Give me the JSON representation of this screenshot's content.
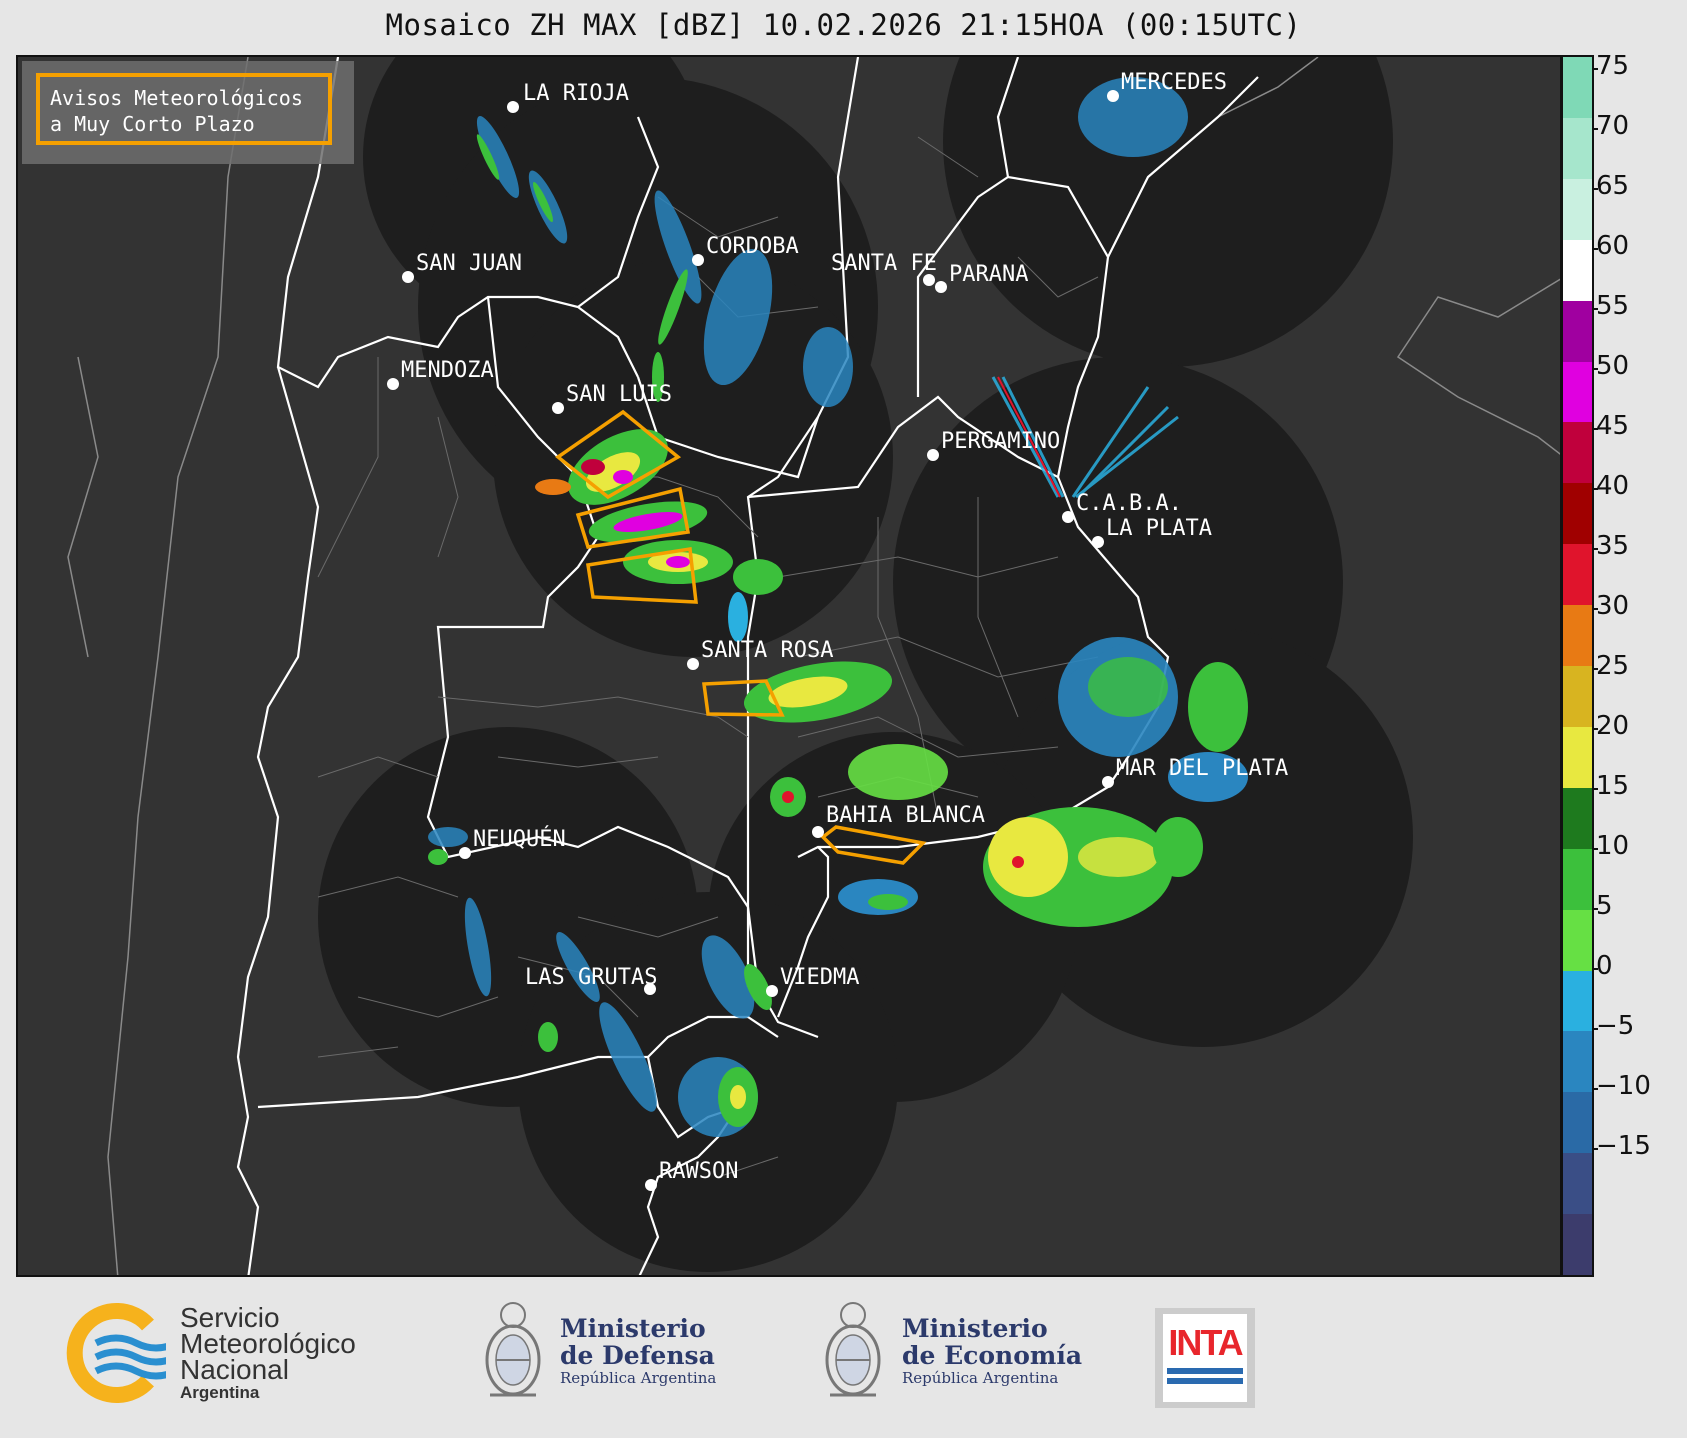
{
  "title": "Mosaico ZH MAX [dBZ] 10.02.2026 21:15HOA (00:15UTC)",
  "warning_box": {
    "line1": "Avisos Meteorológicos",
    "line2": "a Muy Corto Plazo",
    "border_color": "#f5a000"
  },
  "cities": [
    {
      "name": "LA RIOJA"
    },
    {
      "name": "CORDOBA"
    },
    {
      "name": "SAN JUAN"
    },
    {
      "name": "SANTA FE"
    },
    {
      "name": "PARANA"
    },
    {
      "name": "MENDOZA"
    },
    {
      "name": "SAN LUIS"
    },
    {
      "name": "PERGAMINO"
    },
    {
      "name": "C.A.B.A."
    },
    {
      "name": "LA PLATA"
    },
    {
      "name": "SANTA ROSA"
    },
    {
      "name": "MAR DEL PLATA"
    },
    {
      "name": "BAHIA BLANCA"
    },
    {
      "name": "NEUQUÉN"
    },
    {
      "name": "LAS GRUTAS"
    },
    {
      "name": "VIEDMA"
    },
    {
      "name": "RAWSON"
    },
    {
      "name": "MERCEDES"
    }
  ],
  "colorbar": {
    "ticks": [
      "75",
      "70",
      "65",
      "60",
      "55",
      "50",
      "45",
      "40",
      "35",
      "30",
      "25",
      "20",
      "15",
      "10",
      "5",
      "0",
      "−5",
      "−10",
      "−15"
    ],
    "colors": [
      "#7fd9b6",
      "#a6e6cc",
      "#c9f0e0",
      "#ffffff",
      "#a000a0",
      "#e000e0",
      "#c0003c",
      "#a00000",
      "#e0142c",
      "#e87a14",
      "#d8b420",
      "#e8e840",
      "#1e7a1e",
      "#3cc03c",
      "#66e044",
      "#2ab0e0",
      "#2a86c0",
      "#2a6aa6",
      "#3a4e86",
      "#3c3c6c"
    ]
  },
  "logos": {
    "smn": {
      "line1": "Servicio",
      "line2": "Meteorológico",
      "line3": "Nacional",
      "line4": "Argentina"
    },
    "defensa": {
      "line1": "Ministerio",
      "line2": "de Defensa",
      "line3": "República Argentina"
    },
    "economia": {
      "line1": "Ministerio",
      "line2": "de Economía",
      "line3": "República Argentina"
    },
    "inta": {
      "label": "INTA"
    }
  }
}
